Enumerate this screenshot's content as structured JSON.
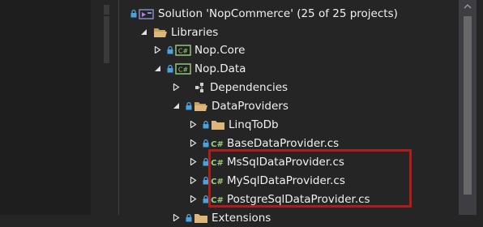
{
  "solution_explorer": {
    "rows": [
      {
        "label": "Solution 'NopCommerce' (25 of 25 projects)",
        "icon": "solution-icon",
        "expander": "none"
      },
      {
        "label": "Libraries",
        "icon": "folder-icon",
        "expander": "expanded"
      },
      {
        "label": "Nop.Core",
        "icon": "csharp-project-icon",
        "expander": "collapsed"
      },
      {
        "label": "Nop.Data",
        "icon": "csharp-project-icon",
        "expander": "expanded"
      },
      {
        "label": "Dependencies",
        "icon": "dependencies-icon",
        "expander": "collapsed"
      },
      {
        "label": "DataProviders",
        "icon": "open-folder-icon",
        "expander": "expanded"
      },
      {
        "label": "LinqToDb",
        "icon": "folder-icon",
        "expander": "collapsed"
      },
      {
        "label": "BaseDataProvider.cs",
        "icon": "csharp-file-icon",
        "expander": "collapsed"
      },
      {
        "label": "MsSqlDataProvider.cs",
        "icon": "csharp-file-icon",
        "expander": "collapsed"
      },
      {
        "label": "MySqlDataProvider.cs",
        "icon": "csharp-file-icon",
        "expander": "collapsed"
      },
      {
        "label": "PostgreSqlDataProvider.cs",
        "icon": "csharp-file-icon",
        "expander": "collapsed"
      },
      {
        "label": "Extensions",
        "icon": "folder-icon",
        "expander": "collapsed"
      }
    ]
  },
  "colors": {
    "background": "#252526",
    "folder": "#dcb67a",
    "csharp": "#9bd27c",
    "lock": "#4aa3df",
    "highlight_border": "#b01c1c"
  }
}
